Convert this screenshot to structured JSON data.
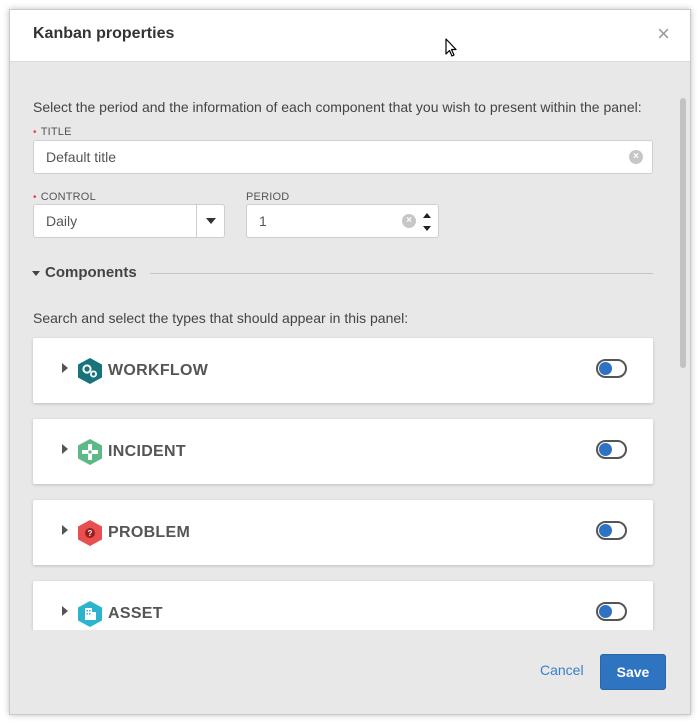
{
  "dialog": {
    "title": "Kanban properties",
    "close_symbol": "×"
  },
  "intro_text": "Select the period and the information of each component that you wish to present within the panel:",
  "title_field": {
    "label": "TITLE",
    "required_mark": "•",
    "value": "Default title"
  },
  "control_field": {
    "label": "CONTROL",
    "required_mark": "•",
    "value": "Daily"
  },
  "period_field": {
    "label": "PERIOD",
    "value": "1"
  },
  "components": {
    "section_title": "Components",
    "hint": "Search and select the types that should appear in this panel:",
    "items": [
      {
        "label": "WORKFLOW",
        "icon": "gears-icon",
        "color": "#17747a",
        "enabled": false
      },
      {
        "label": "INCIDENT",
        "icon": "cross-arrows-icon",
        "color": "#5dba87",
        "enabled": false
      },
      {
        "label": "PROBLEM",
        "icon": "question-icon",
        "color": "#e84f4f",
        "enabled": false
      },
      {
        "label": "ASSET",
        "icon": "building-icon",
        "color": "#2cb4cf",
        "enabled": false
      }
    ]
  },
  "footer": {
    "cancel_label": "Cancel",
    "save_label": "Save"
  },
  "colors": {
    "accent": "#2f74c0",
    "required": "#e0474c"
  }
}
